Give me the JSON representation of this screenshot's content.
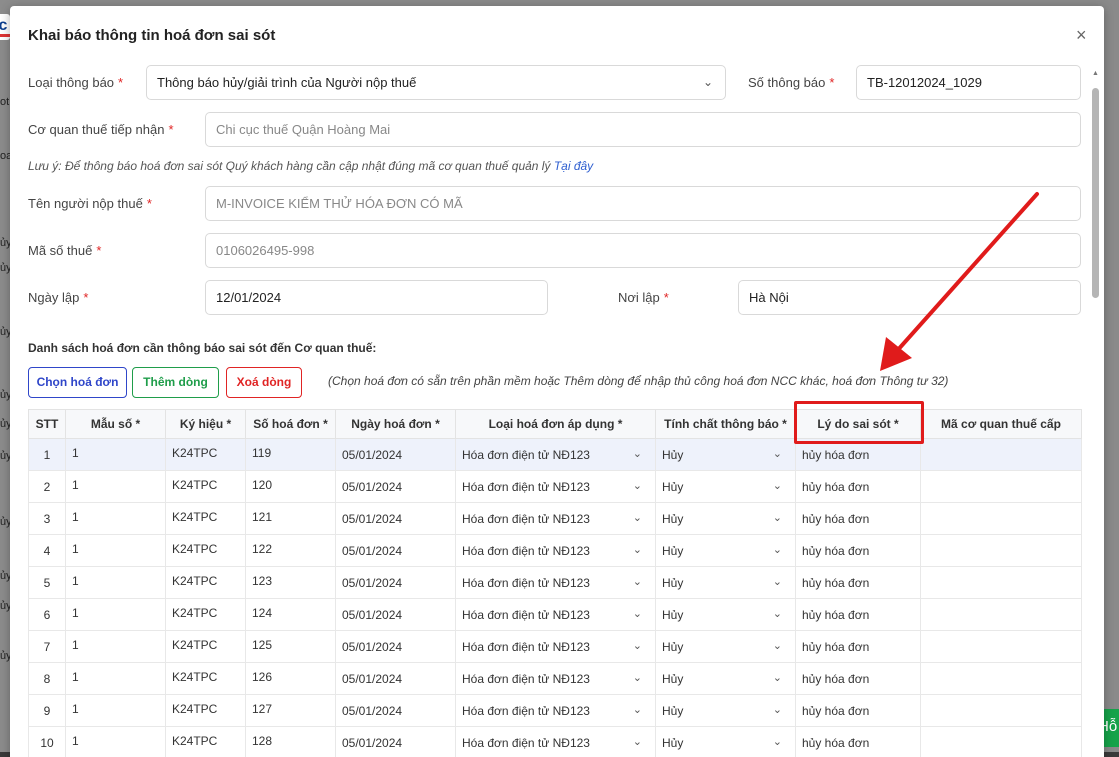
{
  "background": {
    "left_texts": [
      "ot",
      "oa",
      "ủy",
      "ủy",
      "ủy",
      "ủy",
      "ủy",
      "ủy",
      "ủy",
      "ủy",
      "ủy",
      "ủy"
    ],
    "chat_label": "Hỗ"
  },
  "modal": {
    "title": "Khai báo thông tin hoá đơn sai sót",
    "close_label": "×"
  },
  "form": {
    "notice_type": {
      "label": "Loại thông báo",
      "required": "*",
      "value": "Thông báo hủy/giải trình của Người nộp thuế"
    },
    "notice_no": {
      "label": "Số thông báo",
      "required": "*",
      "value": "TB-12012024_1029"
    },
    "tax_office": {
      "label": "Cơ quan thuế tiếp nhận",
      "required": "*",
      "value": "Chi cục thuế Quận Hoàng Mai"
    },
    "note": {
      "text": "Lưu ý: Để thông báo hoá đơn sai sót Quý khách hàng cần cập nhật đúng mã cơ quan thuế quản lý",
      "link": "Tại đây"
    },
    "taxpayer_name": {
      "label": "Tên người nộp thuế",
      "required": "*",
      "value": "M-INVOICE KIỂM THỬ HÓA ĐƠN CÓ MÃ"
    },
    "tax_code": {
      "label": "Mã số thuế",
      "required": "*",
      "value": "0106026495-998"
    },
    "date": {
      "label": "Ngày lập",
      "required": "*",
      "value": "12/01/2024"
    },
    "place": {
      "label": "Nơi lập",
      "required": "*",
      "value": "Hà Nội"
    }
  },
  "invoice_section": {
    "title": "Danh sách hoá đơn cần thông báo sai sót đến Cơ quan thuế:",
    "buttons": {
      "choose": "Chọn hoá đơn",
      "add": "Thêm dòng",
      "delete": "Xoá dòng"
    },
    "hint": "(Chọn hoá đơn có sẵn trên phần mềm hoặc Thêm dòng để nhập thủ công hoá đơn NCC khác, hoá đơn Thông tư 32)"
  },
  "table": {
    "headers": [
      "STT",
      "Mẫu số *",
      "Ký hiệu *",
      "Số hoá đơn *",
      "Ngày hoá đơn *",
      "Loại hoá đơn áp dụng *",
      "Tính chất thông báo *",
      "Lý do sai sót *",
      "Mã cơ quan thuế cấp"
    ],
    "rows": [
      {
        "stt": "1",
        "mau": "1",
        "kyhieu": "K24TPC",
        "so": "119",
        "ngay": "05/01/2024",
        "loai": "Hóa đơn điện tử NĐ123",
        "tinhchat": "Hủy",
        "lydo": "hủy  hóa đơn",
        "ma": ""
      },
      {
        "stt": "2",
        "mau": "1",
        "kyhieu": "K24TPC",
        "so": "120",
        "ngay": "05/01/2024",
        "loai": "Hóa đơn điện tử NĐ123",
        "tinhchat": "Hủy",
        "lydo": "hủy  hóa đơn",
        "ma": ""
      },
      {
        "stt": "3",
        "mau": "1",
        "kyhieu": "K24TPC",
        "so": "121",
        "ngay": "05/01/2024",
        "loai": "Hóa đơn điện tử NĐ123",
        "tinhchat": "Hủy",
        "lydo": "hủy  hóa đơn",
        "ma": ""
      },
      {
        "stt": "4",
        "mau": "1",
        "kyhieu": "K24TPC",
        "so": "122",
        "ngay": "05/01/2024",
        "loai": "Hóa đơn điện tử NĐ123",
        "tinhchat": "Hủy",
        "lydo": "hủy  hóa đơn",
        "ma": ""
      },
      {
        "stt": "5",
        "mau": "1",
        "kyhieu": "K24TPC",
        "so": "123",
        "ngay": "05/01/2024",
        "loai": "Hóa đơn điện tử NĐ123",
        "tinhchat": "Hủy",
        "lydo": "hủy  hóa đơn",
        "ma": ""
      },
      {
        "stt": "6",
        "mau": "1",
        "kyhieu": "K24TPC",
        "so": "124",
        "ngay": "05/01/2024",
        "loai": "Hóa đơn điện tử NĐ123",
        "tinhchat": "Hủy",
        "lydo": "hủy  hóa đơn",
        "ma": ""
      },
      {
        "stt": "7",
        "mau": "1",
        "kyhieu": "K24TPC",
        "so": "125",
        "ngay": "05/01/2024",
        "loai": "Hóa đơn điện tử NĐ123",
        "tinhchat": "Hủy",
        "lydo": "hủy  hóa đơn",
        "ma": ""
      },
      {
        "stt": "8",
        "mau": "1",
        "kyhieu": "K24TPC",
        "so": "126",
        "ngay": "05/01/2024",
        "loai": "Hóa đơn điện tử NĐ123",
        "tinhchat": "Hủy",
        "lydo": "hủy  hóa đơn",
        "ma": ""
      },
      {
        "stt": "9",
        "mau": "1",
        "kyhieu": "K24TPC",
        "so": "127",
        "ngay": "05/01/2024",
        "loai": "Hóa đơn điện tử NĐ123",
        "tinhchat": "Hủy",
        "lydo": "hủy  hóa đơn",
        "ma": ""
      },
      {
        "stt": "10",
        "mau": "1",
        "kyhieu": "K24TPC",
        "so": "128",
        "ngay": "05/01/2024",
        "loai": "Hóa đơn điện tử NĐ123",
        "tinhchat": "Hủy",
        "lydo": "hủy  hóa đơn",
        "ma": ""
      }
    ]
  },
  "icons": {
    "chevron": "chevron-down-icon",
    "close": "close-icon"
  },
  "colors": {
    "required": "#e02424",
    "primary_blue": "#2f46c9",
    "green": "#1f9d4a",
    "annotation_red": "#e01b1b",
    "chat_green": "#16a34a"
  }
}
